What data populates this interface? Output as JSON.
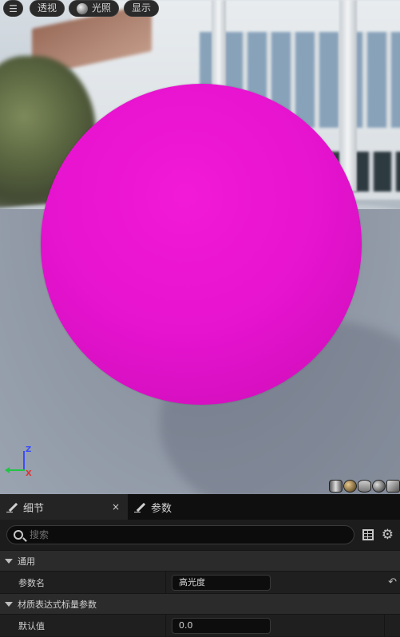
{
  "viewport": {
    "menu_icon": "hamburger-icon",
    "perspective_label": "透视",
    "lighting_label": "光照",
    "show_label": "显示",
    "axis_z": "Z",
    "axis_x": "X",
    "preview_shapes": [
      "cylinder",
      "sphere",
      "plane",
      "cube-sphere",
      "teapot"
    ]
  },
  "panel": {
    "tabs": [
      {
        "label": "细节",
        "icon": "pencil-icon",
        "active": true
      },
      {
        "label": "参数",
        "icon": "pencil-icon",
        "active": false
      }
    ],
    "close_symbol": "×",
    "search_placeholder": "搜索",
    "sections": {
      "general": {
        "title": "通用",
        "param_name_label": "参数名",
        "param_name_value": "高光度"
      },
      "scalar": {
        "title": "材质表达式标量参数",
        "default_label": "默认值",
        "default_value": "0.0"
      }
    },
    "reset_symbol": "↶"
  },
  "colors": {
    "sphere": "#e614cf",
    "panel_bg": "#151515",
    "accent_z": "#3a4cff",
    "accent_x": "#e0322f",
    "accent_y": "#22c544"
  }
}
